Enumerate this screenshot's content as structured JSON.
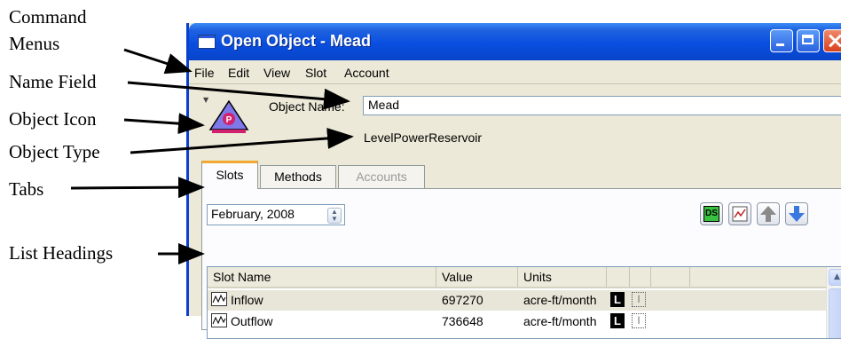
{
  "callouts": {
    "command_menus": "Command\nMenus",
    "command_menus_line1": "Command",
    "command_menus_line2": "Menus",
    "name_field": "Name Field",
    "object_icon": "Object Icon",
    "object_type": "Object Type",
    "tabs": "Tabs",
    "list_headings": "List Headings"
  },
  "window": {
    "title": "Open Object - Mead"
  },
  "menu": [
    "File",
    "Edit",
    "View",
    "Slot",
    "Account"
  ],
  "object": {
    "name_label": "Object Name:",
    "name_value": "Mead",
    "type": "LevelPowerReservoir",
    "icon_letter": "P"
  },
  "tabs": [
    "Slots",
    "Methods",
    "Accounts"
  ],
  "date": "February, 2008",
  "toolbar_icons": [
    "ds-icon",
    "plot-icon",
    "up-arrow-icon",
    "down-arrow-icon"
  ],
  "list": {
    "headers": [
      "Slot Name",
      "Value",
      "Units"
    ],
    "rows": [
      {
        "name": "Inflow",
        "value": "697270",
        "units": "acre-ft/month",
        "flag": "L"
      },
      {
        "name": "Outflow",
        "value": "736648",
        "units": "acre-ft/month",
        "flag": "L"
      }
    ]
  },
  "colors": {
    "titlebar": "#0a4ee0",
    "icon_fill": "#7e78e8",
    "icon_badge": "#d0206e",
    "active_tab_accent": "#f0a830",
    "ds_button": "#3ac040"
  }
}
